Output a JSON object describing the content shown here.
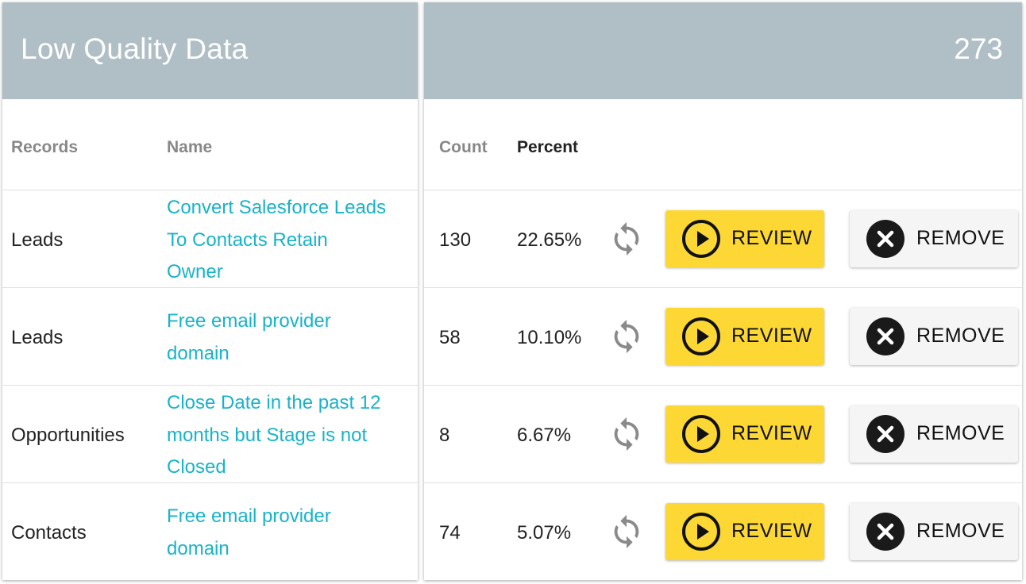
{
  "header": {
    "title": "Low Quality Data",
    "total": "273",
    "background_color": "#b0bec5"
  },
  "columns": {
    "records": "Records",
    "name": "Name",
    "count": "Count",
    "percent": "Percent"
  },
  "rows": [
    {
      "record": "Leads",
      "name_lines": [
        "Convert Salesforce Leads",
        "To Contacts Retain",
        "Owner"
      ],
      "count": "130",
      "percent": "22.65%",
      "review_label": "REVIEW",
      "remove_label": "REMOVE"
    },
    {
      "record": "Leads",
      "name_lines": [
        "Free email provider",
        "domain"
      ],
      "count": "58",
      "percent": "10.10%",
      "review_label": "REVIEW",
      "remove_label": "REMOVE"
    },
    {
      "record": "Opportunities",
      "name_lines": [
        "Close Date in the past 12",
        "months but Stage is not",
        "Closed"
      ],
      "count": "8",
      "percent": "6.67%",
      "review_label": "REVIEW",
      "remove_label": "REMOVE"
    },
    {
      "record": "Contacts",
      "name_lines": [
        "Free email provider",
        "domain"
      ],
      "count": "74",
      "percent": "5.07%",
      "review_label": "REVIEW",
      "remove_label": "REMOVE"
    }
  ],
  "icons": {
    "refresh": "refresh-icon",
    "review": "play-circle-icon",
    "remove": "close-circle-icon"
  },
  "colors": {
    "link": "#17b3c9",
    "review_button": "#fdd835",
    "remove_button": "#f5f5f5"
  }
}
